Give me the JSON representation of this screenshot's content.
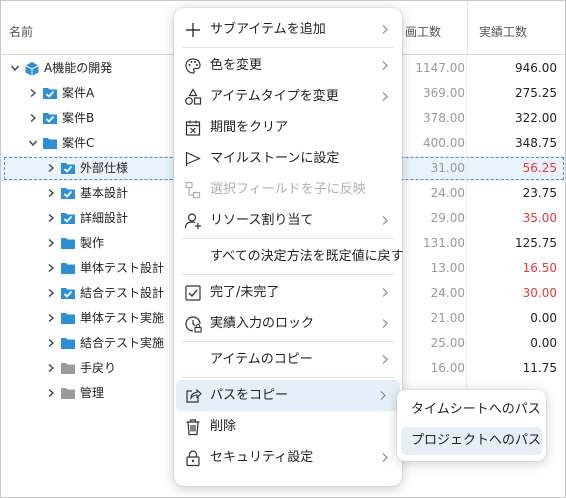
{
  "grid": {
    "headers": {
      "name": "名前",
      "plan": "画工数",
      "actual": "実績工数"
    },
    "rows": [
      {
        "label": "A機能の開発",
        "level": 0,
        "toggle": "open",
        "icon": "cube-icon",
        "plan": "1147.00",
        "actual": "946.00",
        "red": false
      },
      {
        "label": "案件A",
        "level": 1,
        "toggle": "closed",
        "icon": "checked-folder-icon",
        "plan": "369.00",
        "actual": "275.25",
        "red": false
      },
      {
        "label": "案件B",
        "level": 1,
        "toggle": "closed",
        "icon": "checked-folder-icon",
        "plan": "378.00",
        "actual": "322.00",
        "red": false
      },
      {
        "label": "案件C",
        "level": 1,
        "toggle": "open",
        "icon": "folder-icon",
        "plan": "400.00",
        "actual": "348.75",
        "red": false
      },
      {
        "label": "外部仕様",
        "level": 2,
        "toggle": "closed",
        "icon": "checked-folder-icon",
        "plan": "31.00",
        "actual": "56.25",
        "red": true,
        "selected": true
      },
      {
        "label": "基本設計",
        "level": 2,
        "toggle": "closed",
        "icon": "checked-folder-icon",
        "plan": "24.00",
        "actual": "23.75",
        "red": false
      },
      {
        "label": "詳細設計",
        "level": 2,
        "toggle": "closed",
        "icon": "checked-folder-icon",
        "plan": "29.00",
        "actual": "35.00",
        "red": true
      },
      {
        "label": "製作",
        "level": 2,
        "toggle": "closed",
        "icon": "folder-icon",
        "plan": "131.00",
        "actual": "125.75",
        "red": false
      },
      {
        "label": "単体テスト設計",
        "level": 2,
        "toggle": "closed",
        "icon": "folder-icon",
        "plan": "13.00",
        "actual": "16.50",
        "red": true
      },
      {
        "label": "結合テスト設計",
        "level": 2,
        "toggle": "closed",
        "icon": "checked-folder-icon",
        "plan": "24.00",
        "actual": "30.00",
        "red": true
      },
      {
        "label": "単体テスト実施",
        "level": 2,
        "toggle": "closed",
        "icon": "folder-icon",
        "plan": "21.00",
        "actual": "0.00",
        "red": false
      },
      {
        "label": "結合テスト実施",
        "level": 2,
        "toggle": "closed",
        "icon": "folder-icon",
        "plan": "25.00",
        "actual": "0.00",
        "red": false
      },
      {
        "label": "手戻り",
        "level": 2,
        "toggle": "closed",
        "icon": "gray-folder-icon",
        "plan": "16.00",
        "actual": "11.75",
        "red": false
      },
      {
        "label": "管理",
        "level": 2,
        "toggle": "closed",
        "icon": "gray-folder-icon",
        "plan": "",
        "actual": "",
        "red": false
      }
    ]
  },
  "menu": {
    "items": [
      {
        "label": "サブアイテムを追加",
        "icon": "plus-icon",
        "submenu": true,
        "disabled": false
      },
      {
        "label": "色を変更",
        "icon": "palette-icon",
        "submenu": true,
        "disabled": false
      },
      {
        "label": "アイテムタイプを変更",
        "icon": "shapes-icon",
        "submenu": true,
        "disabled": false
      },
      {
        "label": "期間をクリア",
        "icon": "calendar-clear-icon",
        "submenu": false,
        "disabled": false
      },
      {
        "label": "マイルストーンに設定",
        "icon": "flag-icon",
        "submenu": false,
        "disabled": false
      },
      {
        "label": "選択フィールドを子に反映",
        "icon": "hierarchy-icon",
        "submenu": false,
        "disabled": true
      },
      {
        "label": "リソース割り当て",
        "icon": "add-person-icon",
        "submenu": true,
        "disabled": false
      },
      {
        "label": "すべての決定方法を既定値に戻す",
        "icon": "",
        "submenu": false,
        "disabled": false
      },
      {
        "label": "完了/未完了",
        "icon": "checkbox-icon",
        "submenu": true,
        "disabled": false
      },
      {
        "label": "実績入力のロック",
        "icon": "clock-lock-icon",
        "submenu": true,
        "disabled": false
      },
      {
        "label": "アイテムのコピー",
        "icon": "",
        "submenu": true,
        "disabled": false
      },
      {
        "label": "パスをコピー",
        "icon": "share-icon",
        "submenu": true,
        "disabled": false,
        "active": true
      },
      {
        "label": "削除",
        "icon": "trash-icon",
        "submenu": false,
        "disabled": false
      },
      {
        "label": "セキュリティ設定",
        "icon": "lock-icon",
        "submenu": true,
        "disabled": false
      }
    ],
    "submenu": [
      {
        "label": "タイムシートへのパス",
        "active": false
      },
      {
        "label": "プロジェクトへのパス",
        "active": true
      }
    ]
  },
  "colors": {
    "accent": "#2d8fd5",
    "folder": "#2d8fd5",
    "gray_folder": "#9a9a9a",
    "cube": "#2d8fd5",
    "red_value": "#e53935",
    "selection_bg": "#eaf3fb",
    "menu_hover": "#e6eef7"
  }
}
